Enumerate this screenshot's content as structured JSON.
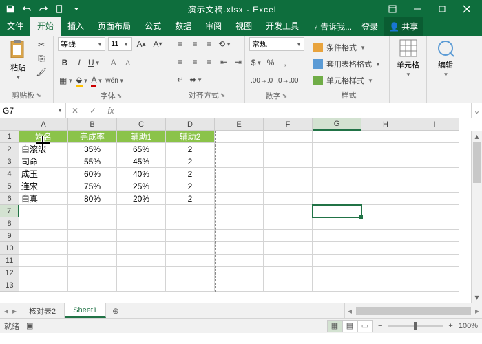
{
  "titlebar": {
    "title": "演示文稿.xlsx - Excel"
  },
  "tabs": {
    "file": "文件",
    "home": "开始",
    "insert": "插入",
    "layout": "页面布局",
    "formulas": "公式",
    "data": "数据",
    "review": "审阅",
    "view": "视图",
    "dev": "开发工具",
    "tellme": "告诉我...",
    "signin": "登录",
    "share": "共享"
  },
  "ribbon": {
    "clipboard": {
      "label": "剪贴板",
      "paste": "粘贴"
    },
    "font": {
      "label": "字体",
      "name": "等线",
      "size": "11"
    },
    "align": {
      "label": "对齐方式"
    },
    "number": {
      "label": "数字",
      "format": "常规"
    },
    "styles": {
      "label": "样式",
      "cond": "条件格式",
      "table": "套用表格格式",
      "cell": "单元格样式"
    },
    "cells": {
      "label": "单元格"
    },
    "editing": {
      "label": "编辑"
    }
  },
  "namebox": "G7",
  "formula": "",
  "cols": [
    "A",
    "B",
    "C",
    "D",
    "E",
    "F",
    "G",
    "H",
    "I"
  ],
  "rows": [
    "1",
    "2",
    "3",
    "4",
    "5",
    "6",
    "7",
    "8",
    "9",
    "10",
    "11",
    "12",
    "13"
  ],
  "headers": {
    "a": "姓名",
    "b": "完成率",
    "c": "辅助1",
    "d": "辅助2"
  },
  "data": [
    {
      "a": "白滚滚",
      "b": "35%",
      "c": "65%",
      "d": "2"
    },
    {
      "a": "司命",
      "b": "55%",
      "c": "45%",
      "d": "2"
    },
    {
      "a": "成玉",
      "b": "60%",
      "c": "40%",
      "d": "2"
    },
    {
      "a": "连宋",
      "b": "75%",
      "c": "25%",
      "d": "2"
    },
    {
      "a": "白真",
      "b": "80%",
      "c": "20%",
      "d": "2"
    }
  ],
  "sheets": {
    "s1": "核对表2",
    "s2": "Sheet1"
  },
  "status": {
    "ready": "就绪",
    "macro": "",
    "zoom": "100%"
  },
  "active_cell": "G7",
  "chart_data": {
    "type": "table",
    "columns": [
      "姓名",
      "完成率",
      "辅助1",
      "辅助2"
    ],
    "rows": [
      [
        "白滚滚",
        0.35,
        0.65,
        2
      ],
      [
        "司命",
        0.55,
        0.45,
        2
      ],
      [
        "成玉",
        0.6,
        0.4,
        2
      ],
      [
        "连宋",
        0.75,
        0.25,
        2
      ],
      [
        "白真",
        0.8,
        0.2,
        2
      ]
    ]
  }
}
